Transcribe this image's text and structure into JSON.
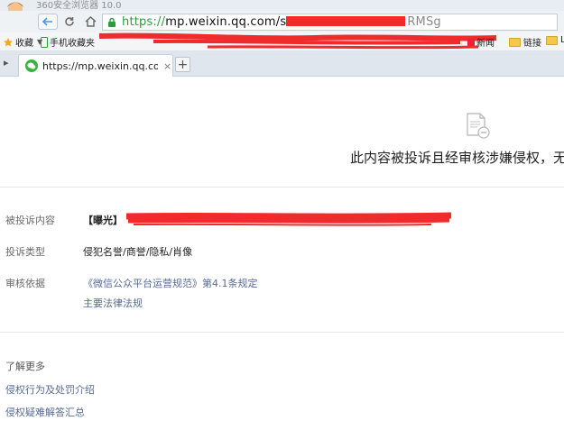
{
  "browser": {
    "title": "360安全浏览器 10.0",
    "address": {
      "prefix": "https://",
      "domain": "mp.weixin.qq.com/s",
      "tail": "RMSg"
    },
    "bookmarks": {
      "favorites": "收藏",
      "mobile_favorites": "手机收藏夹",
      "news": "新闻",
      "links": "链接",
      "more": "Li"
    },
    "tab": {
      "title": "https://mp.weixin.qq.com/s/m",
      "close": "×",
      "new_tab": "+"
    }
  },
  "page": {
    "notice": "此内容被投诉且经审核涉嫌侵权，无法",
    "complaint_content_label": "被投诉内容",
    "complaint_content_value": "【曝光】",
    "complaint_type_label": "投诉类型",
    "complaint_type_value": "侵犯名誉/商誉/隐私/肖像",
    "review_basis_label": "审核依据",
    "review_basis_rule": "《微信公众平台运营规范》第4.1条规定",
    "review_basis_laws": "主要法律法规",
    "learn_more": "了解更多",
    "infringement_intro": "侵权行为及处罚介绍",
    "infringement_faq": "侵权疑难解答汇总"
  },
  "colors": {
    "redaction": "#ef2b2b",
    "link": "#576b95",
    "secure_green": "#2b9b3f",
    "wechat_green": "#35b53b"
  }
}
